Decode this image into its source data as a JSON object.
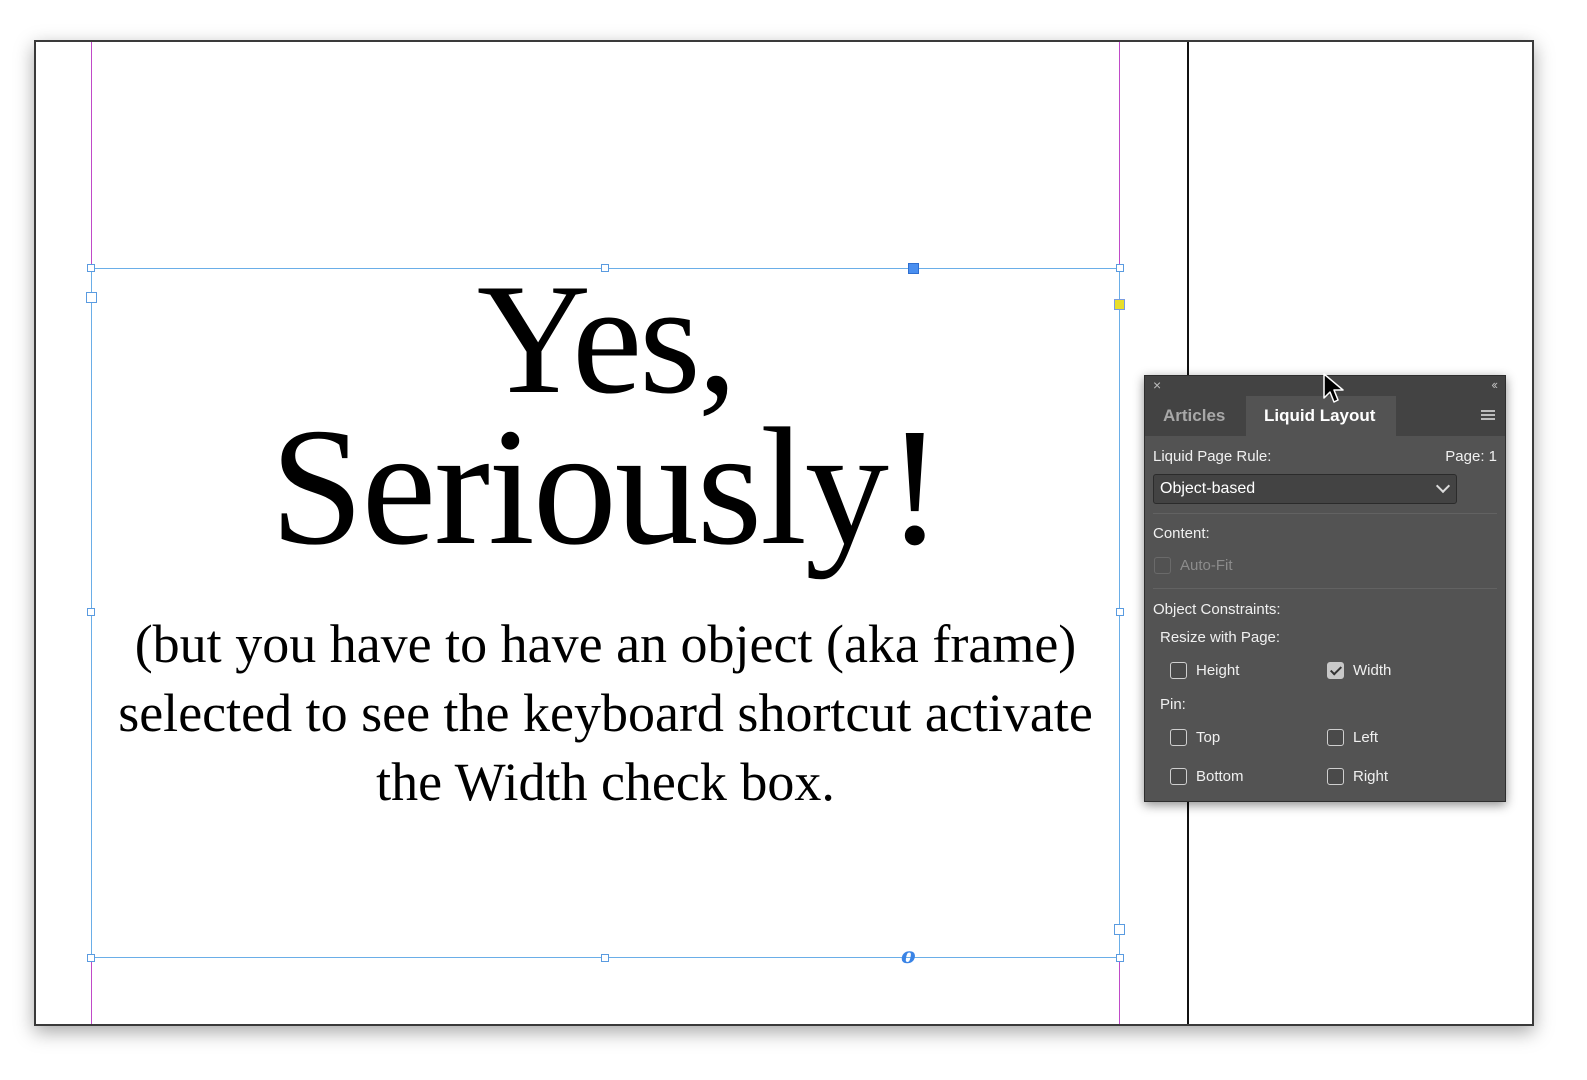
{
  "document": {
    "headline_line1": "Yes,",
    "headline_line2": "Seriously!",
    "body_lines": [
      "(but you have to have an object (aka frame)",
      "selected to see the keyboard shortcut activate",
      "the Width check box."
    ],
    "anchor_glyph": "o"
  },
  "panel": {
    "close_glyph": "×",
    "collapse_glyph": "‹‹",
    "tabs": [
      "Articles",
      "Liquid Layout"
    ],
    "active_tab": "Liquid Layout",
    "page_rule_label": "Liquid Page Rule:",
    "page_indicator": "Page: 1",
    "page_rule_value": "Object-based",
    "content_label": "Content:",
    "auto_fit_label": "Auto-Fit",
    "auto_fit_checked": false,
    "object_constraints_label": "Object Constraints:",
    "resize_with_page_label": "Resize with Page:",
    "height_label": "Height",
    "height_checked": false,
    "width_label": "Width",
    "width_checked": true,
    "pin_label": "Pin:",
    "top_label": "Top",
    "left_label": "Left",
    "bottom_label": "Bottom",
    "right_label": "Right"
  },
  "colors": {
    "margin_guide": "#c04ac8",
    "frame_selection": "#6aaee8",
    "panel_bg": "#535353",
    "panel_header": "#434343"
  },
  "icons": [
    "close-icon",
    "collapse-icon",
    "panel-menu-icon",
    "chevron-down-icon",
    "checkmark-icon",
    "mouse-pointer-icon"
  ]
}
